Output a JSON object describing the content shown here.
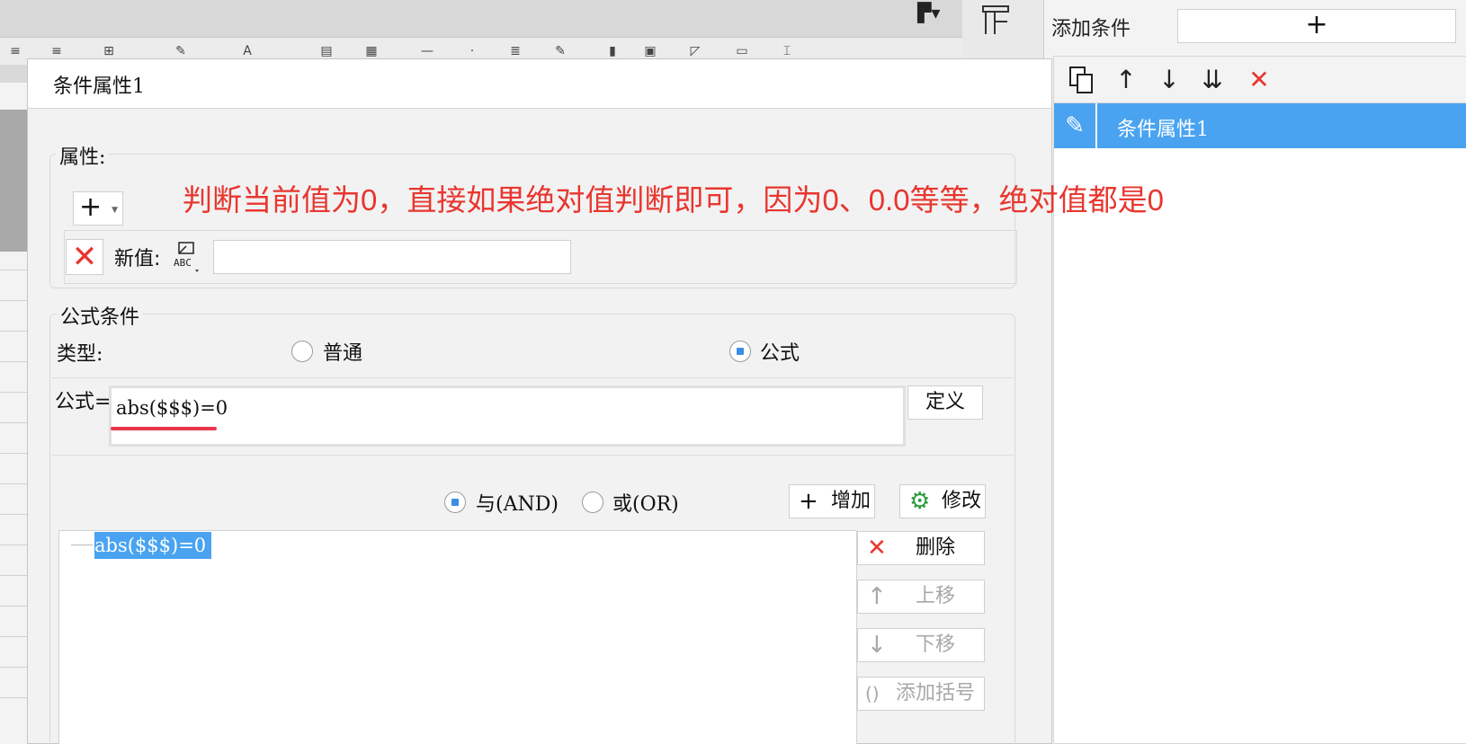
{
  "background": {
    "icons": [
      "align-icon",
      "list-icon",
      "table-icon",
      "format-icon",
      "text-icon",
      "grid-icon",
      "grid2-icon",
      "minus-icon",
      "dot-icon",
      "lines-icon",
      "edit-icon",
      "chart-icon",
      "image-icon",
      "shape-icon",
      "doc-icon",
      "frame-icon"
    ]
  },
  "right_panel": {
    "add_condition_label": "添加条件",
    "add_button_symbol": "+",
    "items": [
      {
        "label": "条件属性1",
        "selected": true
      }
    ]
  },
  "dialog": {
    "title": "条件属性1",
    "properties": {
      "label": "属性:",
      "new_value_label": "新值:",
      "abc_label": "ABC",
      "new_value": ""
    },
    "annotation": "判断当前值为0，直接如果绝对值判断即可，因为0、0.0等等，绝对值都是0",
    "formula_condition": {
      "label": "公式条件",
      "type_label": "类型:",
      "options": [
        "普通",
        "公式"
      ],
      "selected_type": "公式",
      "formula_label": "公式=",
      "formula_value": "abs($$$)=0",
      "define_button": "定义",
      "logic_and": "与(AND)",
      "logic_or": "或(OR)",
      "selected_logic": "与(AND)",
      "add_button": "增加",
      "modify_button": "修改",
      "delete_button": "删除",
      "move_up_button": "上移",
      "move_down_button": "下移",
      "add_bracket_button": "添加括号",
      "conditions": [
        "abs($$$)=0"
      ]
    }
  },
  "colors": {
    "accent": "#4aa3f0",
    "annotation": "#e8362f",
    "delete": "#e8362f"
  }
}
